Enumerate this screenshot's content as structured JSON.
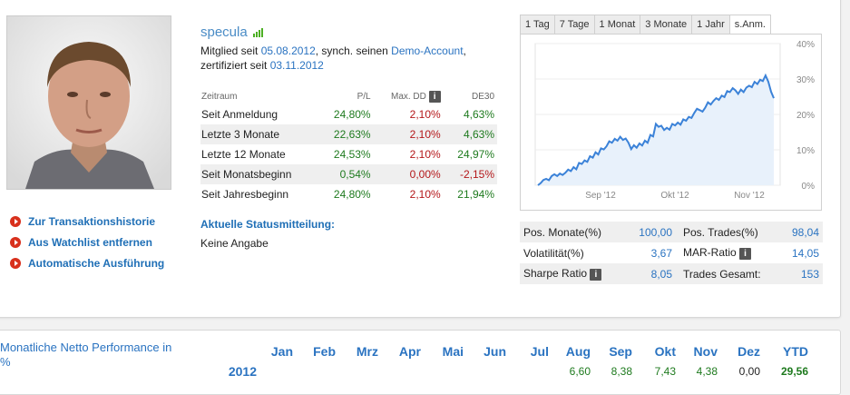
{
  "profile": {
    "username": "specula",
    "member_prefix": "Mitglied seit ",
    "member_since": "05.08.2012",
    "sync_text": ", synch. seinen ",
    "account_link": "Demo-Account",
    "comma": ",",
    "cert_prefix": "zertifiziert seit ",
    "certified": "03.11.2012"
  },
  "actions": [
    {
      "label": "Zur Transaktionshistorie"
    },
    {
      "label": "Aus Watchlist entfernen"
    },
    {
      "label": "Automatische Ausführung"
    }
  ],
  "performance": {
    "headers": [
      "Zeitraum",
      "P/L",
      "Max. DD",
      "DE30"
    ],
    "info_icon": "info-icon",
    "rows": [
      {
        "label": "Seit Anmeldung",
        "pl": "24,80%",
        "dd": "2,10%",
        "de30": "4,63%",
        "de30_color": "#1e7a1e"
      },
      {
        "label": "Letzte 3 Monate",
        "pl": "22,63%",
        "dd": "2,10%",
        "de30": "4,63%",
        "de30_color": "#1e7a1e"
      },
      {
        "label": "Letzte 12 Monate",
        "pl": "24,53%",
        "dd": "2,10%",
        "de30": "24,97%",
        "de30_color": "#1e7a1e"
      },
      {
        "label": "Seit Monatsbeginn",
        "pl": "0,54%",
        "dd": "0,00%",
        "de30": "-2,15%",
        "de30_color": "#b4171a"
      },
      {
        "label": "Seit Jahresbeginn",
        "pl": "24,80%",
        "dd": "2,10%",
        "de30": "21,94%",
        "de30_color": "#1e7a1e"
      }
    ]
  },
  "status": {
    "heading": "Aktuelle Statusmitteilung:",
    "text": "Keine Angabe"
  },
  "tabs": [
    {
      "label": "1 Tag"
    },
    {
      "label": "7 Tage"
    },
    {
      "label": "1 Monat"
    },
    {
      "label": "3 Monate"
    },
    {
      "label": "1 Jahr"
    },
    {
      "label": "s.Anm.",
      "active": true
    }
  ],
  "chart_data": {
    "type": "area",
    "y_ticks": [
      "40%",
      "30%",
      "20%",
      "10%",
      "0%"
    ],
    "ylim": [
      0,
      40
    ],
    "x_ticks": [
      "Sep '12",
      "Okt '12",
      "Nov '12"
    ],
    "line_color": "#3b82d8",
    "fill_color": "#e8f1fb",
    "series": [
      {
        "values": [
          0,
          0.6,
          1.5,
          1.8,
          1.4,
          2.6,
          3.1,
          2.6,
          3.3,
          2.9,
          3.5,
          4.4,
          4.0,
          5.1,
          4.5,
          6.3,
          6.0,
          7.0,
          6.6,
          8.2,
          7.8,
          9.3,
          8.7,
          10.4,
          10.1,
          11.0,
          12.4,
          12.0,
          13.1,
          12.6,
          13.7,
          12.8,
          13.2,
          12.0,
          10.2,
          11.3,
          10.6,
          11.8,
          11.2,
          12.6,
          12.0,
          14.2,
          13.8,
          17.3,
          16.5,
          16.8,
          15.6,
          16.2,
          15.7,
          17.3,
          16.9,
          17.7,
          17.1,
          18.6,
          18.2,
          19.3,
          19.0,
          20.4,
          21.6,
          21.2,
          20.8,
          21.9,
          23.4,
          22.8,
          23.8,
          24.6,
          24.1,
          25.3,
          24.9,
          26.6,
          26.3,
          27.4,
          26.8,
          25.8,
          27.0,
          26.3,
          27.6,
          28.1,
          27.7,
          29.2,
          28.6,
          29.8,
          29.4,
          31.0,
          29.2,
          26.4,
          24.6
        ]
      }
    ]
  },
  "stats": [
    {
      "l1": "Pos. Monate(%)",
      "v1": "100,00",
      "l2": "Pos. Trades(%)",
      "v2": "98,04"
    },
    {
      "l1": "Volatilität(%)",
      "v1": "3,67",
      "l2": "MAR-Ratio",
      "v2": "14,05"
    },
    {
      "l1": "Sharpe Ratio",
      "v1": "8,05",
      "l2": "Trades Gesamt:",
      "v2": "153"
    }
  ],
  "monthly": {
    "label": "Monatliche Netto Performance in %",
    "months": [
      "Jan",
      "Feb",
      "Mrz",
      "Apr",
      "Mai",
      "Jun",
      "Jul",
      "Aug",
      "Sep",
      "Okt",
      "Nov",
      "Dez",
      "YTD"
    ],
    "year": "2012",
    "values": [
      "",
      "",
      "",
      "",
      "",
      "",
      "",
      "6,60",
      "8,38",
      "7,43",
      "4,38",
      "0,00",
      "29,56"
    ]
  }
}
